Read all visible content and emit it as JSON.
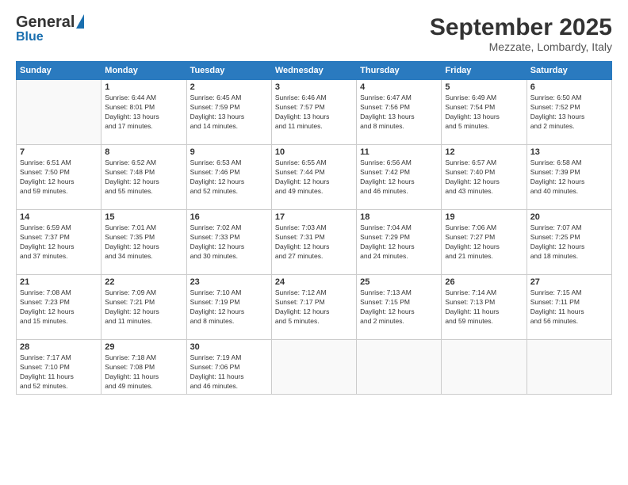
{
  "logo": {
    "general": "General",
    "blue": "Blue"
  },
  "header": {
    "month": "September 2025",
    "location": "Mezzate, Lombardy, Italy"
  },
  "weekdays": [
    "Sunday",
    "Monday",
    "Tuesday",
    "Wednesday",
    "Thursday",
    "Friday",
    "Saturday"
  ],
  "weeks": [
    [
      {
        "day": "",
        "info": ""
      },
      {
        "day": "1",
        "info": "Sunrise: 6:44 AM\nSunset: 8:01 PM\nDaylight: 13 hours\nand 17 minutes."
      },
      {
        "day": "2",
        "info": "Sunrise: 6:45 AM\nSunset: 7:59 PM\nDaylight: 13 hours\nand 14 minutes."
      },
      {
        "day": "3",
        "info": "Sunrise: 6:46 AM\nSunset: 7:57 PM\nDaylight: 13 hours\nand 11 minutes."
      },
      {
        "day": "4",
        "info": "Sunrise: 6:47 AM\nSunset: 7:56 PM\nDaylight: 13 hours\nand 8 minutes."
      },
      {
        "day": "5",
        "info": "Sunrise: 6:49 AM\nSunset: 7:54 PM\nDaylight: 13 hours\nand 5 minutes."
      },
      {
        "day": "6",
        "info": "Sunrise: 6:50 AM\nSunset: 7:52 PM\nDaylight: 13 hours\nand 2 minutes."
      }
    ],
    [
      {
        "day": "7",
        "info": "Sunrise: 6:51 AM\nSunset: 7:50 PM\nDaylight: 12 hours\nand 59 minutes."
      },
      {
        "day": "8",
        "info": "Sunrise: 6:52 AM\nSunset: 7:48 PM\nDaylight: 12 hours\nand 55 minutes."
      },
      {
        "day": "9",
        "info": "Sunrise: 6:53 AM\nSunset: 7:46 PM\nDaylight: 12 hours\nand 52 minutes."
      },
      {
        "day": "10",
        "info": "Sunrise: 6:55 AM\nSunset: 7:44 PM\nDaylight: 12 hours\nand 49 minutes."
      },
      {
        "day": "11",
        "info": "Sunrise: 6:56 AM\nSunset: 7:42 PM\nDaylight: 12 hours\nand 46 minutes."
      },
      {
        "day": "12",
        "info": "Sunrise: 6:57 AM\nSunset: 7:40 PM\nDaylight: 12 hours\nand 43 minutes."
      },
      {
        "day": "13",
        "info": "Sunrise: 6:58 AM\nSunset: 7:39 PM\nDaylight: 12 hours\nand 40 minutes."
      }
    ],
    [
      {
        "day": "14",
        "info": "Sunrise: 6:59 AM\nSunset: 7:37 PM\nDaylight: 12 hours\nand 37 minutes."
      },
      {
        "day": "15",
        "info": "Sunrise: 7:01 AM\nSunset: 7:35 PM\nDaylight: 12 hours\nand 34 minutes."
      },
      {
        "day": "16",
        "info": "Sunrise: 7:02 AM\nSunset: 7:33 PM\nDaylight: 12 hours\nand 30 minutes."
      },
      {
        "day": "17",
        "info": "Sunrise: 7:03 AM\nSunset: 7:31 PM\nDaylight: 12 hours\nand 27 minutes."
      },
      {
        "day": "18",
        "info": "Sunrise: 7:04 AM\nSunset: 7:29 PM\nDaylight: 12 hours\nand 24 minutes."
      },
      {
        "day": "19",
        "info": "Sunrise: 7:06 AM\nSunset: 7:27 PM\nDaylight: 12 hours\nand 21 minutes."
      },
      {
        "day": "20",
        "info": "Sunrise: 7:07 AM\nSunset: 7:25 PM\nDaylight: 12 hours\nand 18 minutes."
      }
    ],
    [
      {
        "day": "21",
        "info": "Sunrise: 7:08 AM\nSunset: 7:23 PM\nDaylight: 12 hours\nand 15 minutes."
      },
      {
        "day": "22",
        "info": "Sunrise: 7:09 AM\nSunset: 7:21 PM\nDaylight: 12 hours\nand 11 minutes."
      },
      {
        "day": "23",
        "info": "Sunrise: 7:10 AM\nSunset: 7:19 PM\nDaylight: 12 hours\nand 8 minutes."
      },
      {
        "day": "24",
        "info": "Sunrise: 7:12 AM\nSunset: 7:17 PM\nDaylight: 12 hours\nand 5 minutes."
      },
      {
        "day": "25",
        "info": "Sunrise: 7:13 AM\nSunset: 7:15 PM\nDaylight: 12 hours\nand 2 minutes."
      },
      {
        "day": "26",
        "info": "Sunrise: 7:14 AM\nSunset: 7:13 PM\nDaylight: 11 hours\nand 59 minutes."
      },
      {
        "day": "27",
        "info": "Sunrise: 7:15 AM\nSunset: 7:11 PM\nDaylight: 11 hours\nand 56 minutes."
      }
    ],
    [
      {
        "day": "28",
        "info": "Sunrise: 7:17 AM\nSunset: 7:10 PM\nDaylight: 11 hours\nand 52 minutes."
      },
      {
        "day": "29",
        "info": "Sunrise: 7:18 AM\nSunset: 7:08 PM\nDaylight: 11 hours\nand 49 minutes."
      },
      {
        "day": "30",
        "info": "Sunrise: 7:19 AM\nSunset: 7:06 PM\nDaylight: 11 hours\nand 46 minutes."
      },
      {
        "day": "",
        "info": ""
      },
      {
        "day": "",
        "info": ""
      },
      {
        "day": "",
        "info": ""
      },
      {
        "day": "",
        "info": ""
      }
    ]
  ]
}
